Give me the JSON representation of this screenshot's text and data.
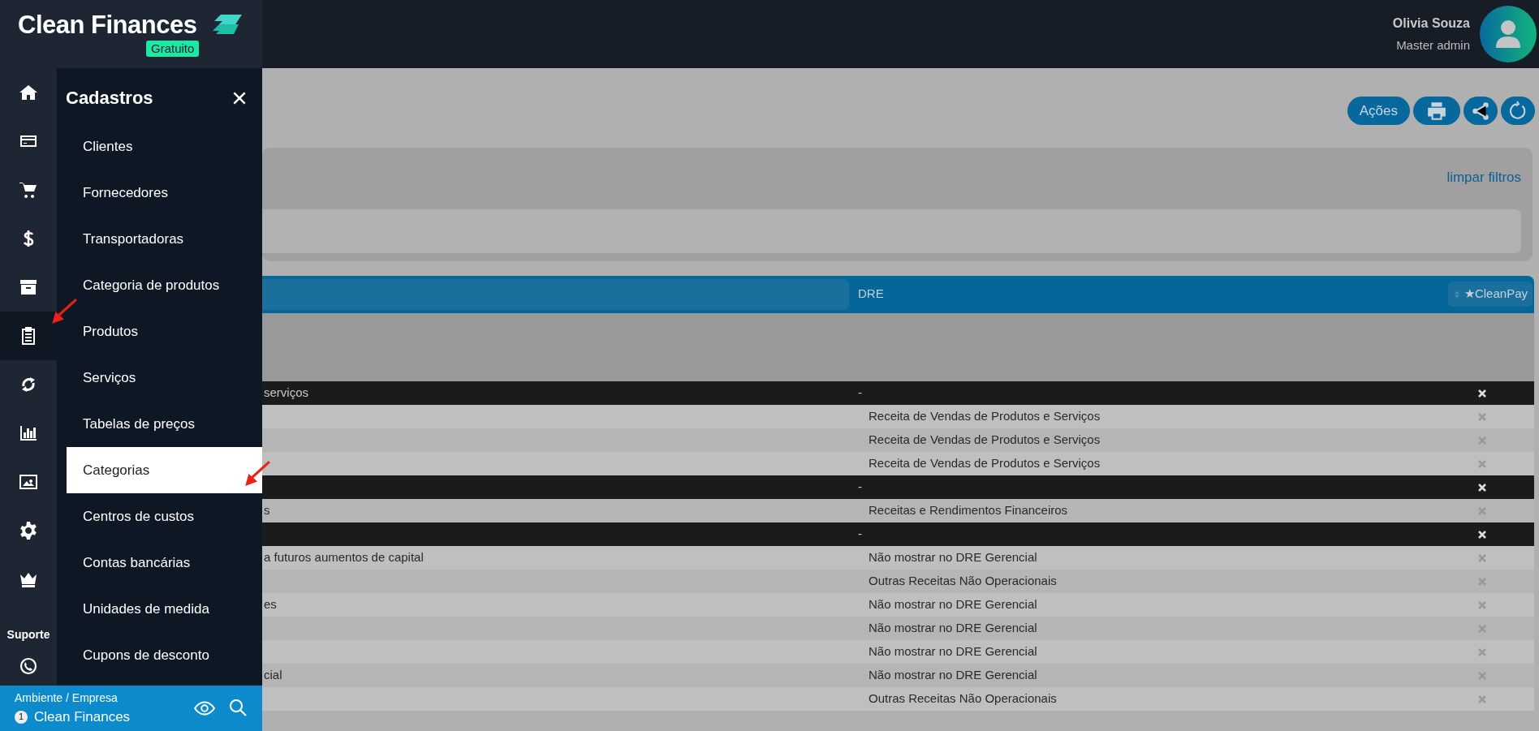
{
  "brand": {
    "name": "Clean Finances",
    "plan": "Gratuito"
  },
  "user": {
    "name": "Olivia Souza",
    "role": "Master admin"
  },
  "rail": [
    {
      "kind": "home",
      "selected": false
    },
    {
      "kind": "card",
      "selected": false
    },
    {
      "kind": "cart",
      "selected": false
    },
    {
      "kind": "dollar",
      "selected": false
    },
    {
      "kind": "archive",
      "selected": false
    },
    {
      "kind": "clipboard",
      "selected": true
    },
    {
      "kind": "exchange",
      "selected": false
    },
    {
      "kind": "chart",
      "selected": false
    },
    {
      "kind": "image",
      "selected": false
    },
    {
      "kind": "gear",
      "selected": false
    },
    {
      "kind": "crown",
      "selected": false
    }
  ],
  "support": {
    "label": "Suporte"
  },
  "submenu": {
    "title": "Cadastros",
    "items": [
      {
        "label": "Clientes",
        "selected": false
      },
      {
        "label": "Fornecedores",
        "selected": false
      },
      {
        "label": "Transportadoras",
        "selected": false
      },
      {
        "label": "Categoria de produtos",
        "selected": false
      },
      {
        "label": "Produtos",
        "selected": false
      },
      {
        "label": "Serviços",
        "selected": false
      },
      {
        "label": "Tabelas de preços",
        "selected": false
      },
      {
        "label": "Categorias",
        "selected": true
      },
      {
        "label": "Centros de custos",
        "selected": false
      },
      {
        "label": "Contas bancárias",
        "selected": false
      },
      {
        "label": "Unidades de medida",
        "selected": false
      },
      {
        "label": "Cupons de desconto",
        "selected": false
      }
    ]
  },
  "environment": {
    "label": "Ambiente / Empresa",
    "number": "1",
    "company": "Clean Finances"
  },
  "actions": {
    "label": "Ações"
  },
  "filters": {
    "clear_link": "limpar filtros"
  },
  "table": {
    "columns": [
      "DRE",
      "★CleanPay"
    ],
    "rows": [
      {
        "kind": "group",
        "column_1": "serviços",
        "dre": "-"
      },
      {
        "kind": "item",
        "column_1": "",
        "dre": "Receita de Vendas de Produtos e Serviços"
      },
      {
        "kind": "item",
        "column_1": "",
        "dre": "Receita de Vendas de Produtos e Serviços"
      },
      {
        "kind": "item",
        "column_1": "",
        "dre": "Receita de Vendas de Produtos e Serviços"
      },
      {
        "kind": "group",
        "column_1": "",
        "dre": "-"
      },
      {
        "kind": "item",
        "column_1": "s",
        "dre": "Receitas e Rendimentos Financeiros"
      },
      {
        "kind": "group",
        "column_1": "",
        "dre": "-"
      },
      {
        "kind": "item",
        "column_1": "a futuros aumentos de capital",
        "dre": "Não mostrar no DRE Gerencial"
      },
      {
        "kind": "item",
        "column_1": "",
        "dre": "Outras Receitas Não Operacionais"
      },
      {
        "kind": "item",
        "column_1": "es",
        "dre": "Não mostrar no DRE Gerencial"
      },
      {
        "kind": "item",
        "column_1": "",
        "dre": "Não mostrar no DRE Gerencial"
      },
      {
        "kind": "item",
        "column_1": "",
        "dre": "Não mostrar no DRE Gerencial"
      },
      {
        "kind": "item",
        "column_1": "cial",
        "dre": "Não mostrar no DRE Gerencial"
      },
      {
        "kind": "item",
        "column_1": "",
        "dre": "Outras Receitas Não Operacionais"
      }
    ]
  }
}
